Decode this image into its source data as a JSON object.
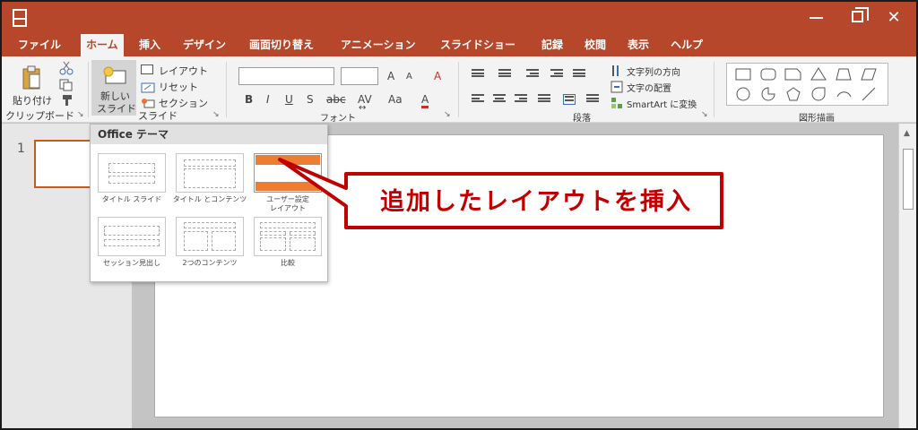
{
  "title_bar": {
    "app_icon": "slides-icon",
    "window_controls": [
      "minimize-icon",
      "restore-icon",
      "close-icon"
    ],
    "close_glyph": "✕"
  },
  "tabs": [
    {
      "label": "ファイル",
      "active": false
    },
    {
      "label": "ホーム",
      "active": true
    },
    {
      "label": "挿入",
      "active": false
    },
    {
      "label": "デザイン",
      "active": false
    },
    {
      "label": "画面切り替え",
      "active": false
    },
    {
      "label": "アニメーション",
      "active": false
    },
    {
      "label": "スライドショー",
      "active": false
    },
    {
      "label": "記録",
      "active": false
    },
    {
      "label": "校閲",
      "active": false
    },
    {
      "label": "表示",
      "active": false
    },
    {
      "label": "ヘルプ",
      "active": false
    }
  ],
  "ribbon": {
    "clipboard": {
      "paste_label": "貼り付け",
      "group_label": "クリップボード"
    },
    "slides": {
      "new_slide_label_1": "新しい",
      "new_slide_label_2": "スライド",
      "layout_label": "レイアウト",
      "reset_label": "リセット",
      "section_label": "セクション",
      "group_label": "スライド"
    },
    "font": {
      "font_name_value": "",
      "font_size_value": "",
      "grow_label": "A",
      "shrink_label": "A",
      "clear_label": "A",
      "bold_label": "B",
      "italic_label": "I",
      "underline_label": "U",
      "shadow_label": "S",
      "strike_label": "abc",
      "spacing_label": "AV",
      "case_label": "Aa",
      "color_label": "A",
      "group_label": "フォント"
    },
    "paragraph": {
      "text_direction_label": "文字列の方向",
      "align_text_label": "文字の配置",
      "smartart_label": "SmartArt に変換",
      "group_label": "段落"
    },
    "drawing": {
      "group_label": "図形描画",
      "shapes": [
        "rectangle",
        "rounded-rectangle",
        "snip-rectangle",
        "triangle",
        "trapezoid",
        "parallelogram",
        "circle",
        "pie",
        "pentagon",
        "teardrop",
        "arc",
        "diagonal-stripe"
      ]
    }
  },
  "thumbnail_pane": {
    "slide_number": "1"
  },
  "layout_dropdown": {
    "header": "Office テーマ",
    "layouts": [
      {
        "name": "タイトル スライド",
        "name2": ""
      },
      {
        "name": "タイトル とコンテンツ",
        "name2": ""
      },
      {
        "name": "ユーザー設定",
        "name2": "レイアウト"
      },
      {
        "name": "セッション見出し",
        "name2": ""
      },
      {
        "name": "2つのコンテンツ",
        "name2": ""
      },
      {
        "name": "比較",
        "name2": ""
      }
    ]
  },
  "callout": {
    "text": "追加したレイアウトを挿入"
  },
  "colors": {
    "title_bar": "#b7472a",
    "accent": "#ed7d31",
    "thumbnail_border": "#c55a1c",
    "callout": "#c00000"
  }
}
